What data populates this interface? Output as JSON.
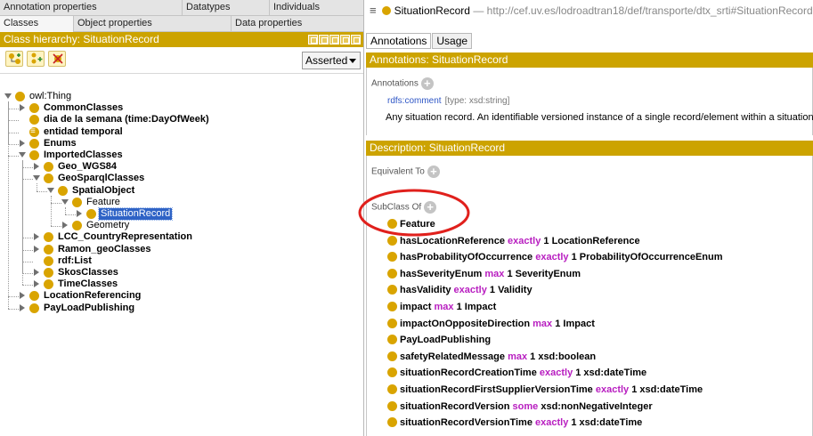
{
  "left": {
    "tabs_row1": [
      "Annotation properties",
      "Datatypes",
      "Individuals"
    ],
    "tabs_row2": [
      "Classes",
      "Object properties",
      "Data properties"
    ],
    "hierarchy_title": "Class hierarchy: SituationRecord",
    "view_mode": "Asserted",
    "tree": [
      {
        "label": "owl:Thing",
        "bold": false,
        "toggle": "open",
        "level": 0,
        "eq": false
      },
      {
        "label": "CommonClasses",
        "bold": true,
        "toggle": "closed",
        "level": 1,
        "eq": false
      },
      {
        "label": "dia de la semana (time:DayOfWeek)",
        "bold": true,
        "toggle": "none",
        "level": 1,
        "eq": false
      },
      {
        "label": "entidad temporal",
        "bold": true,
        "toggle": "none",
        "level": 1,
        "eq": true
      },
      {
        "label": "Enums",
        "bold": true,
        "toggle": "closed",
        "level": 1,
        "eq": false
      },
      {
        "label": "ImportedClasses",
        "bold": true,
        "toggle": "open",
        "level": 1,
        "eq": false
      },
      {
        "label": "Geo_WGS84",
        "bold": true,
        "toggle": "closed",
        "level": 2,
        "eq": false
      },
      {
        "label": "GeoSparqlClasses",
        "bold": true,
        "toggle": "open",
        "level": 2,
        "eq": false
      },
      {
        "label": "SpatialObject",
        "bold": true,
        "toggle": "open",
        "level": 3,
        "eq": false
      },
      {
        "label": "Feature",
        "bold": false,
        "toggle": "open",
        "level": 4,
        "eq": false
      },
      {
        "label": "SituationRecord",
        "bold": false,
        "toggle": "closed",
        "level": 5,
        "eq": false,
        "selected": true
      },
      {
        "label": "Geometry",
        "bold": false,
        "toggle": "closed",
        "level": 4,
        "eq": false
      },
      {
        "label": "LCC_CountryRepresentation",
        "bold": true,
        "toggle": "closed",
        "level": 2,
        "eq": false
      },
      {
        "label": "Ramon_geoClasses",
        "bold": true,
        "toggle": "closed",
        "level": 2,
        "eq": false
      },
      {
        "label": "rdf:List",
        "bold": true,
        "toggle": "none",
        "level": 2,
        "eq": false
      },
      {
        "label": "SkosClasses",
        "bold": true,
        "toggle": "closed",
        "level": 2,
        "eq": false
      },
      {
        "label": "TimeClasses",
        "bold": true,
        "toggle": "closed",
        "level": 2,
        "eq": false
      },
      {
        "label": "LocationReferencing",
        "bold": true,
        "toggle": "closed",
        "level": 1,
        "eq": false
      },
      {
        "label": "PayLoadPublishing",
        "bold": true,
        "toggle": "closed",
        "level": 1,
        "eq": false
      }
    ]
  },
  "right": {
    "title": "SituationRecord",
    "uri": "— http://cef.uv.es/lodroadtran18/def/transporte/dtx_srti#SituationRecord",
    "tabs": [
      "Annotations",
      "Usage"
    ],
    "annotations_header": "Annotations: SituationRecord",
    "annotations_label": "Annotations",
    "annotation_property": "rdfs:comment",
    "annotation_type": "[type: xsd:string]",
    "annotation_value": "Any situation record. An identifiable versioned instance of a single record/element within a situation.",
    "description_header": "Description: SituationRecord",
    "equivalent_label": "Equivalent To",
    "subclass_label": "SubClass Of",
    "subclasses": [
      [
        {
          "t": "Feature"
        }
      ],
      [
        {
          "t": "hasLocationReference "
        },
        {
          "t": "exactly",
          "kw": true
        },
        {
          "t": " 1 LocationReference"
        }
      ],
      [
        {
          "t": "hasProbabilityOfOccurrence "
        },
        {
          "t": "exactly",
          "kw": true
        },
        {
          "t": " 1 ProbabilityOfOccurrenceEnum"
        }
      ],
      [
        {
          "t": "hasSeverityEnum "
        },
        {
          "t": "max",
          "kw": true
        },
        {
          "t": " 1 SeverityEnum"
        }
      ],
      [
        {
          "t": "hasValidity "
        },
        {
          "t": "exactly",
          "kw": true
        },
        {
          "t": " 1 Validity"
        }
      ],
      [
        {
          "t": "impact "
        },
        {
          "t": "max",
          "kw": true
        },
        {
          "t": " 1 Impact"
        }
      ],
      [
        {
          "t": "impactOnOppositeDirection "
        },
        {
          "t": "max",
          "kw": true
        },
        {
          "t": " 1 Impact"
        }
      ],
      [
        {
          "t": "PayLoadPublishing"
        }
      ],
      [
        {
          "t": "safetyRelatedMessage "
        },
        {
          "t": "max",
          "kw": true
        },
        {
          "t": " 1 xsd:boolean"
        }
      ],
      [
        {
          "t": "situationRecordCreationTime "
        },
        {
          "t": "exactly",
          "kw": true
        },
        {
          "t": " 1 xsd:dateTime"
        }
      ],
      [
        {
          "t": "situationRecordFirstSupplierVersionTime "
        },
        {
          "t": "exactly",
          "kw": true
        },
        {
          "t": " 1 xsd:dateTime"
        }
      ],
      [
        {
          "t": "situationRecordVersion "
        },
        {
          "t": "some",
          "kw": true
        },
        {
          "t": " xsd:nonNegativeInteger"
        }
      ],
      [
        {
          "t": "situationRecordVersionTime "
        },
        {
          "t": "exactly",
          "kw": true
        },
        {
          "t": " 1 xsd:dateTime"
        }
      ]
    ]
  },
  "colors": {
    "accent": "#cca300",
    "class_dot": "#d9a400",
    "keyword": "#b81ec0",
    "selection": "#2f63c6",
    "highlight_circle": "#e0201c"
  },
  "icons": [
    "add-subclass-icon",
    "add-sibling-icon",
    "delete-class-icon",
    "menu-icon",
    "plus-icon"
  ]
}
